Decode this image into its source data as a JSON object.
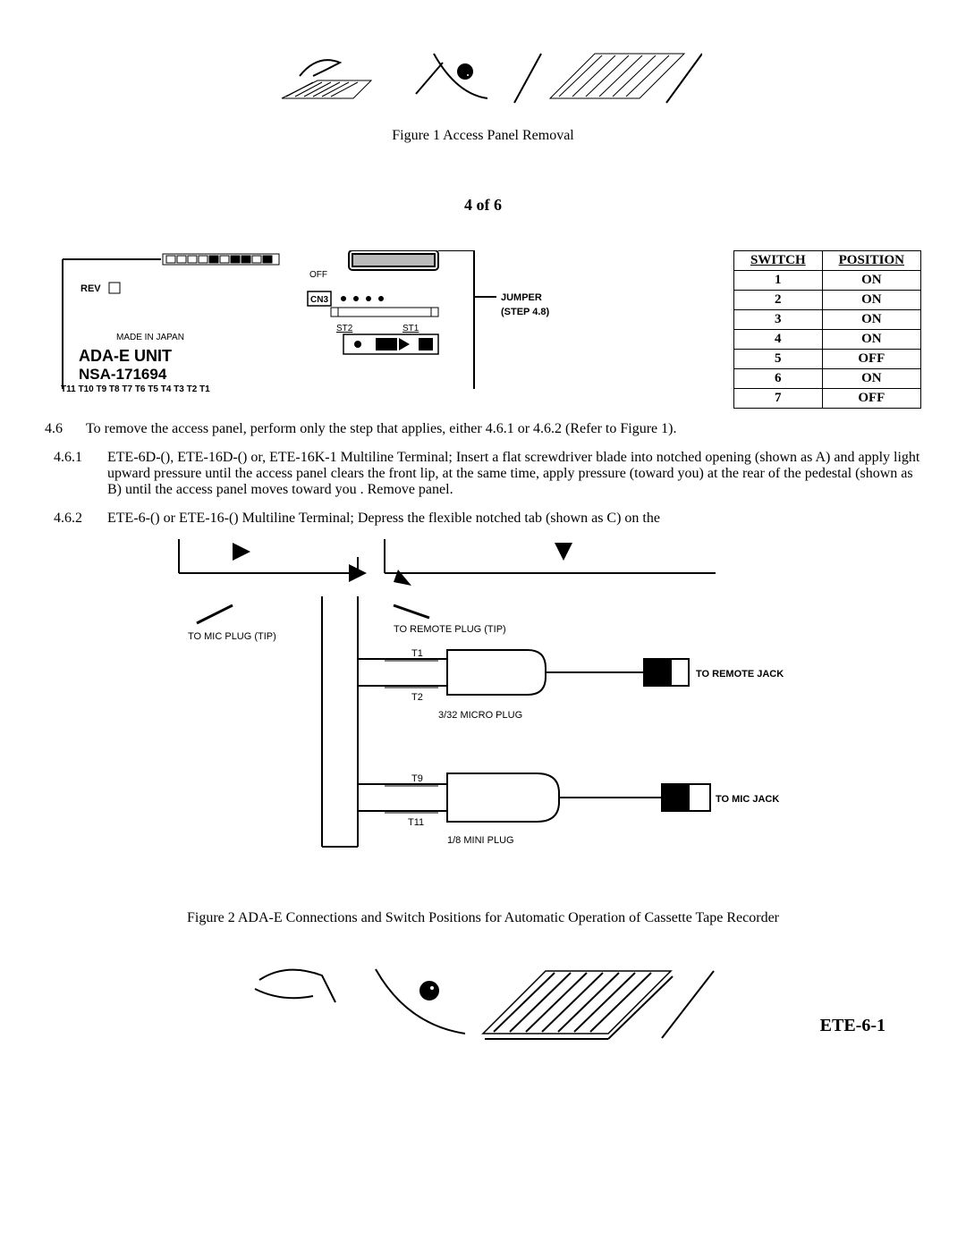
{
  "fig1": {
    "caption": "Figure 1  Access Panel Removal"
  },
  "page_marker": "4 of 6",
  "panel": {
    "off": "OFF",
    "rev": "REV",
    "cn3": "CN3",
    "jumper": "JUMPER",
    "step": "(STEP 4.8)",
    "st2": "ST2",
    "st1": "ST1",
    "made": "MADE IN JAPAN",
    "unit": "ADA-E UNIT",
    "nsa": "NSA-171694",
    "pins": "T11   T10   T9   T8   T7   T6   T5   T4   T3   T2   T1"
  },
  "switch_table": {
    "headers": {
      "switch": "SWITCH",
      "position": "POSITION"
    },
    "rows": [
      {
        "switch": "1",
        "position": "ON"
      },
      {
        "switch": "2",
        "position": "ON"
      },
      {
        "switch": "3",
        "position": "ON"
      },
      {
        "switch": "4",
        "position": "ON"
      },
      {
        "switch": "5",
        "position": "OFF"
      },
      {
        "switch": "6",
        "position": "ON"
      },
      {
        "switch": "7",
        "position": "OFF"
      }
    ]
  },
  "section46": {
    "num": "4.6",
    "text": "To remove the access panel, perform only the step that applies, either 4.6.1 or 4.6.2 (Refer to Figure 1)."
  },
  "section461": {
    "num": "4.6.1",
    "text": "ETE-6D-(), ETE-16D-() or, ETE-16K-1 Multiline Terminal; Insert a flat screwdriver blade into notched opening (shown as A) and apply light upward pressure until the access panel clears the front lip, at the same time, apply pressure (toward you) at the rear of the pedestal (shown as B) until the access panel moves toward you .  Remove panel."
  },
  "section462": {
    "num": "4.6.2",
    "text": "ETE-6-() or ETE-16-() Multiline Terminal; Depress the flexible notched tab (shown as C) on the"
  },
  "wiring": {
    "to_mic_plug": "TO MIC PLUG (TIP)",
    "to_remote_plug": "TO REMOTE PLUG (TIP)",
    "t1": "T1",
    "t2": "T2",
    "to_remote_jack": "TO REMOTE JACK",
    "micro_plug": "3/32 MICRO PLUG",
    "t9": "T9",
    "t11": "T11",
    "to_mic_jack": "TO MIC JACK",
    "mini_plug": "1/8 MINI PLUG"
  },
  "fig2": {
    "caption": "Figure 2  ADA-E Connections and  Switch Positions for Automatic Operation of Cassette Tape Recorder"
  },
  "model": "ETE-6-1",
  "chart_data": {
    "type": "table",
    "title": "Switch Positions",
    "columns": [
      "SWITCH",
      "POSITION"
    ],
    "rows": [
      [
        "1",
        "ON"
      ],
      [
        "2",
        "ON"
      ],
      [
        "3",
        "ON"
      ],
      [
        "4",
        "ON"
      ],
      [
        "5",
        "OFF"
      ],
      [
        "6",
        "ON"
      ],
      [
        "7",
        "OFF"
      ]
    ]
  }
}
